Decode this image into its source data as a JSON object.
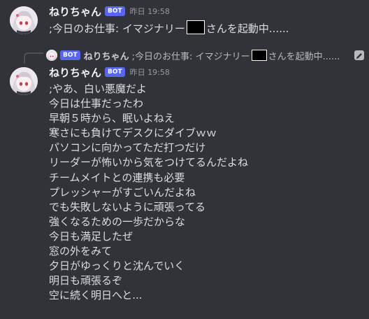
{
  "colors": {
    "background": "#313338",
    "bot_badge": "#5865f2",
    "text": "#dbdee1",
    "timestamp": "#949ba4"
  },
  "message1": {
    "username": "ねりちゃん",
    "badge": "BOT",
    "timestamp": "昨日 19:58",
    "text_before": ";今日のお仕事: イマジナリー",
    "text_after": "さんを起動中......"
  },
  "reply": {
    "badge": "BOT",
    "username": "ねりちゃん",
    "text_before": ";今日のお仕事: イマジナリー",
    "text_after": "さんを起動中......",
    "icon": "pencil-icon"
  },
  "message2": {
    "username": "ねりちゃん",
    "badge": "BOT",
    "timestamp": "昨日 19:58",
    "lines": [
      ";やあ、白い悪魔だよ",
      "今日は仕事だったわ",
      "早朝５時から、眠いよねえ",
      "寒さにも負けてデスクにダイブｗｗ",
      "パソコンに向かってただ打つだけ",
      "リーダーが怖いから気をつけてるんだよね",
      "チームメイトとの連携も必要",
      "プレッシャーがすごいんだよね",
      "でも失敗しないように頑張ってる",
      "強くなるための一歩だからな",
      "今日も満足したぜ",
      "窓の外をみて",
      "夕日がゆっくりと沈んでいく",
      "明日も頑張るぞ",
      "空に続く明日へと..."
    ]
  }
}
